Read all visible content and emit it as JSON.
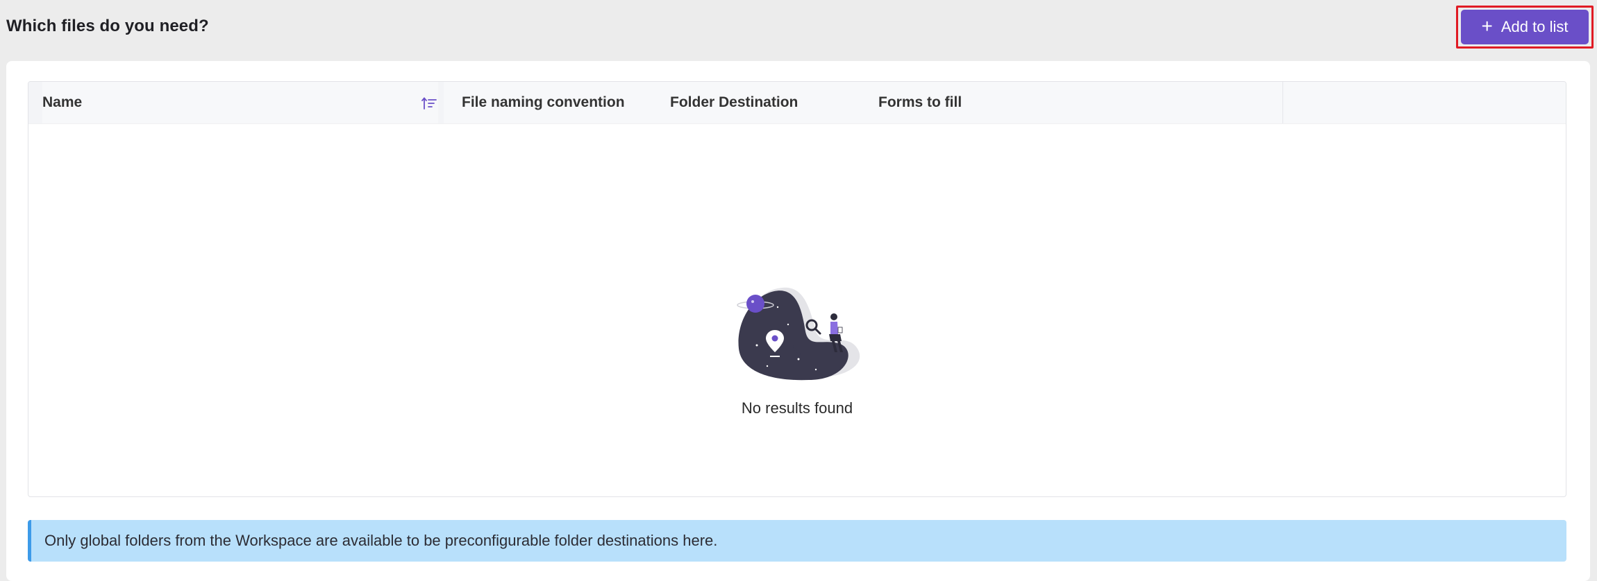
{
  "header": {
    "title": "Which files do you need?",
    "add_button_label": "Add to list",
    "add_button_icon": "plus-icon",
    "accent_color": "#6a4fc8",
    "highlight_color": "#e01b24"
  },
  "table": {
    "columns": [
      {
        "label": "Name",
        "sortable": true,
        "sort_icon": "sort-ascending-icon"
      },
      {
        "label": "File naming convention"
      },
      {
        "label": "Folder Destination"
      },
      {
        "label": "Forms to fill"
      }
    ],
    "rows": [],
    "empty_state": {
      "illustration": "empty-search-illustration",
      "message": "No results found"
    }
  },
  "info_banner": {
    "message": "Only global folders from the Workspace are available to be preconfigurable folder destinations here.",
    "background_color": "#b8e0fb",
    "border_color": "#3d9be9"
  }
}
